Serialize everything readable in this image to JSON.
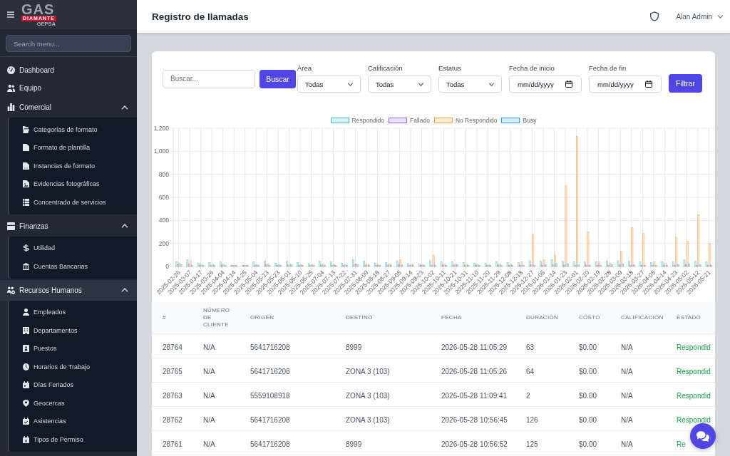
{
  "sidebar": {
    "logo": {
      "title": "GAS",
      "subtitle": "DIAMANTE",
      "tagline": "GEPSA"
    },
    "search": {
      "placeholder": "Search menu..."
    },
    "items": [
      {
        "label": "Dashboard",
        "selected": false
      },
      {
        "label": "Equipo",
        "selected": false
      },
      {
        "label": "Comercial",
        "selected": false,
        "expanded": true,
        "children": [
          {
            "label": "Categorías de formato",
            "selected": false
          },
          {
            "label": "Formato de plantilla",
            "selected": false
          },
          {
            "label": "Instancias de formato",
            "selected": false
          },
          {
            "label": "Evidencias fotográficas",
            "selected": false
          },
          {
            "label": "Concentrado de servicios",
            "selected": false
          }
        ]
      },
      {
        "label": "Finanzas",
        "selected": false,
        "expanded": true,
        "children": [
          {
            "label": "Utilidad",
            "selected": false
          },
          {
            "label": "Cuentas Bancarias",
            "selected": false
          }
        ]
      },
      {
        "label": "Recursos Humanos",
        "selected": true,
        "expanded": true,
        "children": [
          {
            "label": "Empleados",
            "selected": false
          },
          {
            "label": "Departamentos",
            "selected": false
          },
          {
            "label": "Puestos",
            "selected": false
          },
          {
            "label": "Horarios de Trabajo",
            "selected": false
          },
          {
            "label": "Días Feriados",
            "selected": false
          },
          {
            "label": "Geocercas",
            "selected": false
          },
          {
            "label": "Asistencias",
            "selected": false
          },
          {
            "label": "Tipos de Permiso",
            "selected": false
          }
        ]
      }
    ]
  },
  "header": {
    "title": "Registro de llamadas",
    "user": "Alan Admin"
  },
  "filters": {
    "search": {
      "placeholder": "Buscar..."
    },
    "search_button": "Buscar",
    "selects": [
      {
        "label": "Área",
        "value": "Todas"
      },
      {
        "label": "Calificación",
        "value": "Todas"
      },
      {
        "label": "Estatus",
        "value": "Todas"
      }
    ],
    "dates": [
      {
        "label": "Fecha de inicio",
        "placeholder": "mm/dd/yyyy"
      },
      {
        "label": "Fecha de fin",
        "placeholder": "mm/dd/yyyy"
      }
    ],
    "filter_button": "Filtrar"
  },
  "chart": {
    "chart_data": {
      "type": "bar",
      "stacked": false,
      "grid": true,
      "ylim": [
        0,
        1200
      ],
      "yticks": [
        0,
        200,
        400,
        600,
        800,
        {
          "value": 1000,
          "label": "1,000"
        },
        {
          "value": 1200,
          "label": "1,200"
        }
      ],
      "categories": [
        "2025-02-26",
        "2025-03-07",
        "2025-03-17",
        "2025-03-26",
        "2025-04-04",
        "2025-04-14",
        "2025-04-25",
        "2025-05-04",
        "2025-05-13",
        "2025-05-23",
        "2025-06-01",
        "2025-06-10",
        "2025-06-25",
        "2025-07-04",
        "2025-07-13",
        "2025-07-22",
        "2025-07-31",
        "2025-08-09",
        "2025-08-18",
        "2025-08-27",
        "2025-09-05",
        "2025-09-14",
        "2025-09-23",
        "2025-10-02",
        "2025-10-11",
        "2025-10-21",
        "2025-10-31",
        "2025-11-10",
        "2025-11-20",
        "2025-11-29",
        "2025-12-08",
        "2025-12-18",
        "2025-12-27",
        "2026-01-05",
        "2026-01-14",
        "2026-01-23",
        "2026-02-01",
        "2026-02-10",
        "2026-02-19",
        "2026-02-28",
        "2026-03-09",
        "2026-03-18",
        "2026-03-27",
        "2026-04-05",
        "2026-04-14",
        "2026-04-23",
        "2026-05-02",
        "2026-05-12",
        "2026-05-21"
      ],
      "series": [
        {
          "name": "Respondido",
          "color": "#4bc0c0",
          "values": [
            40,
            60,
            30,
            35,
            40,
            12,
            10,
            40,
            45,
            30,
            45,
            35,
            25,
            45,
            40,
            30,
            60,
            45,
            30,
            35,
            50,
            25,
            20,
            50,
            40,
            40,
            35,
            30,
            30,
            40,
            35,
            35,
            50,
            45,
            60,
            45,
            40,
            40,
            40,
            45,
            50,
            45,
            40,
            35,
            40,
            40,
            60,
            45,
            40
          ]
        },
        {
          "name": "Fallado",
          "color": "#9966ff",
          "values": [
            15,
            20,
            12,
            10,
            12,
            10,
            10,
            12,
            15,
            12,
            12,
            10,
            10,
            12,
            12,
            10,
            15,
            12,
            10,
            12,
            15,
            10,
            10,
            12,
            12,
            12,
            10,
            10,
            10,
            12,
            10,
            10,
            15,
            12,
            15,
            12,
            10,
            12,
            10,
            12,
            15,
            12,
            10,
            10,
            12,
            12,
            15,
            12,
            10
          ]
        },
        {
          "name": "No Respondido",
          "color": "#ff9f40",
          "values": [
            30,
            50,
            20,
            15,
            20,
            10,
            10,
            15,
            20,
            15,
            20,
            15,
            15,
            20,
            15,
            15,
            25,
            20,
            15,
            20,
            60,
            20,
            15,
            100,
            20,
            20,
            20,
            15,
            15,
            20,
            20,
            40,
            280,
            60,
            100,
            700,
            1130,
            300,
            40,
            30,
            130,
            340,
            290,
            40,
            30,
            250,
            220,
            450,
            200
          ]
        },
        {
          "name": "Busy",
          "color": "#36a2eb",
          "values": [
            15,
            10,
            10,
            12,
            10,
            10,
            10,
            12,
            10,
            10,
            15,
            10,
            10,
            12,
            10,
            12,
            15,
            12,
            10,
            10,
            12,
            10,
            10,
            12,
            10,
            15,
            10,
            10,
            10,
            12,
            10,
            10,
            12,
            15,
            25,
            20,
            15,
            12,
            10,
            15,
            20,
            15,
            12,
            10,
            12,
            15,
            20,
            15,
            12
          ]
        }
      ]
    }
  },
  "table": {
    "columns": [
      "#",
      "NÚMERO DE CLIENTE",
      "ORIGEN",
      "DESTINO",
      "FECHA",
      "DURACIÓN",
      "COSTO",
      "CALIFICACIÓN",
      "ESTADO"
    ],
    "rows": [
      [
        "28764",
        "N/A",
        "5641716208",
        "8999",
        "2026-05-28 11:05:29",
        "63",
        "$0.00",
        "N/A",
        "Respondid"
      ],
      [
        "28765",
        "N/A",
        "5641716208",
        "ZONA 3 (103)",
        "2026-05-28 11:05:26",
        "64",
        "$0.00",
        "N/A",
        "Respondid"
      ],
      [
        "28763",
        "N/A",
        "5559108918",
        "ZONA 3 (103)",
        "2026-05-28 11:09:41",
        "2",
        "$0.00",
        "N/A",
        "Respondid"
      ],
      [
        "28762",
        "N/A",
        "5641716208",
        "ZONA 3 (103)",
        "2026-05-28 10:56:45",
        "126",
        "$0.00",
        "N/A",
        "Respondid"
      ],
      [
        "28761",
        "N/A",
        "5641716208",
        "8999",
        "2026-05-28 10:56:52",
        "125",
        "$0.00",
        "N/A",
        "Re"
      ]
    ]
  }
}
